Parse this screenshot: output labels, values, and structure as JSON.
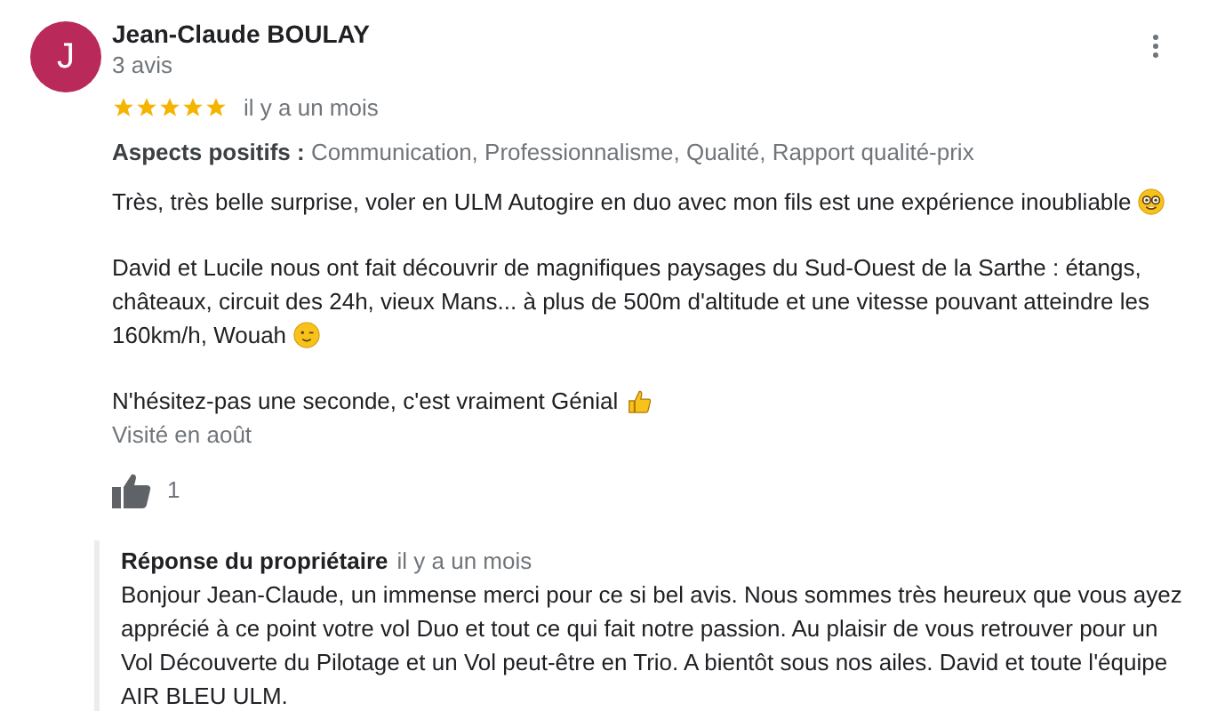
{
  "review": {
    "author": "Jean-Claude BOULAY",
    "avatar_letter": "J",
    "author_meta": "3 avis",
    "stars": 5,
    "date": "il y a un mois",
    "aspects_label": "Aspects positifs :",
    "aspects": "Communication, Professionnalisme, Qualité, Rapport qualité-prix",
    "paragraphs": [
      {
        "lines": [
          "Très, très belle surprise, voler en ULM Autogire en duo avec mon fils est une expérience inoubliable"
        ],
        "kind": "nerd"
      },
      {
        "lines": [
          "David et Lucile nous ont fait découvrir de magnifiques paysages du Sud-Ouest de la Sarthe : étangs,",
          "châteaux, circuit des 24h, vieux Mans... à plus de 500m d'altitude et une vitesse pouvant atteindre les",
          "160km/h, Wouah"
        ],
        "kind": "wink"
      },
      {
        "lines": [
          "N'hésitez-pas une seconde, c'est vraiment Génial"
        ],
        "kind": "thumbs"
      }
    ],
    "visited": "Visité en août",
    "likes": "1"
  },
  "owner_reply": {
    "title": "Réponse du propriétaire",
    "date": "il y a un mois",
    "text": "Bonjour Jean-Claude, un immense merci pour ce si bel avis. Nous sommes très heureux que vous ayez apprécié à ce point votre vol Duo et tout ce qui fait notre passion. Au plaisir de vous retrouver pour un Vol Découverte du Pilotage et un Vol peut-être en Trio. A bientôt sous nos ailes. David et toute l'équipe AIR BLEU ULM."
  }
}
